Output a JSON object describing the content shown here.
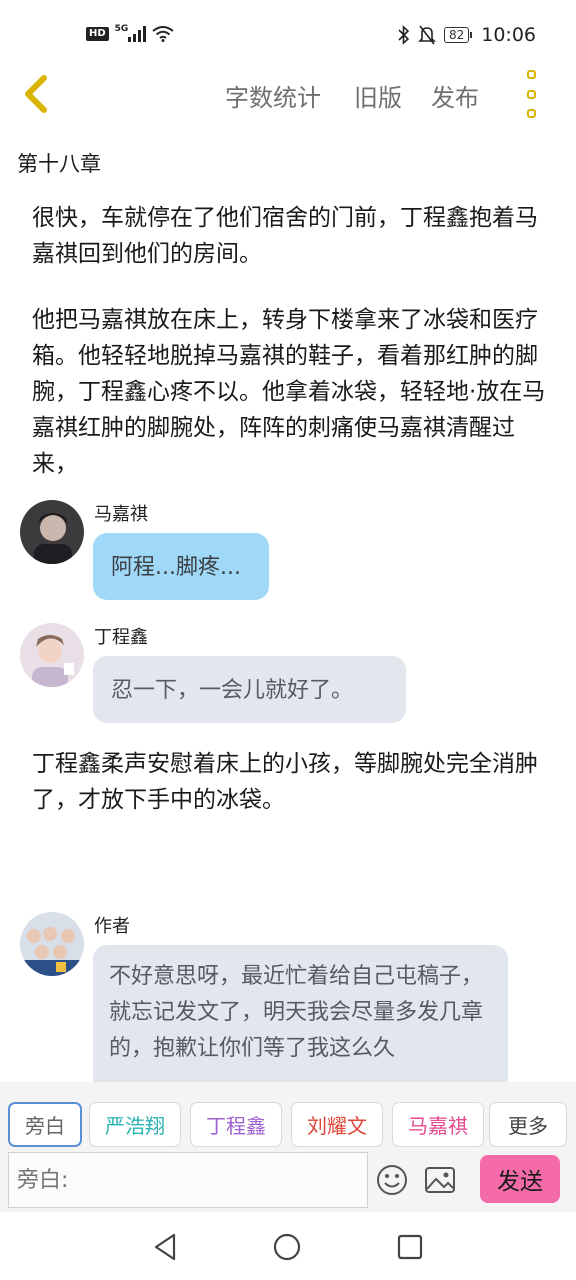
{
  "status_bar": {
    "hd": "HD",
    "network": "5G",
    "battery": "82",
    "time": "10:06"
  },
  "header": {
    "actions": [
      "字数统计",
      "旧版",
      "发布"
    ]
  },
  "chapter_title": "第十八章",
  "story": {
    "paragraphs": [
      "很快，车就停在了他们宿舍的门前，丁程鑫抱着马嘉祺回到他们的房间。",
      "他把马嘉祺放在床上，转身下楼拿来了冰袋和医疗箱。他轻轻地脱掉马嘉祺的鞋子，看着那红肿的脚腕，丁程鑫心疼不以。他拿着冰袋，轻轻地·放在马嘉祺红肿的脚腕处，阵阵的刺痛使马嘉祺清醒过来，",
      "丁程鑫柔声安慰着床上的小孩，等脚腕处完全消肿了，才放下手中的冰袋。"
    ],
    "messages": [
      {
        "name": "马嘉祺",
        "text": "阿程...脚疼..."
      },
      {
        "name": "丁程鑫",
        "text": "忍一下，一会儿就好了。"
      },
      {
        "name": "作者",
        "text": "不好意思呀，最近忙着给自己屯稿子，就忘记发文了，明天我会尽量多发几章的，抱歉让你们等了我这么久"
      }
    ]
  },
  "role_chips": [
    {
      "label": "旁白",
      "color": "#666666"
    },
    {
      "label": "严浩翔",
      "color": "#2bb3b3"
    },
    {
      "label": "丁程鑫",
      "color": "#a05fd0"
    },
    {
      "label": "刘耀文",
      "color": "#e0453a"
    },
    {
      "label": "马嘉祺",
      "color": "#e24b8e"
    },
    {
      "label": "更多",
      "color": "#444444"
    }
  ],
  "composer": {
    "placeholder": "旁白:",
    "send_label": "发送"
  },
  "colors": {
    "accent_yellow": "#d9b400",
    "send_pink": "#f56aa8",
    "bubble_blue": "#9fd9f7",
    "bubble_gray": "#e2e6ed"
  }
}
